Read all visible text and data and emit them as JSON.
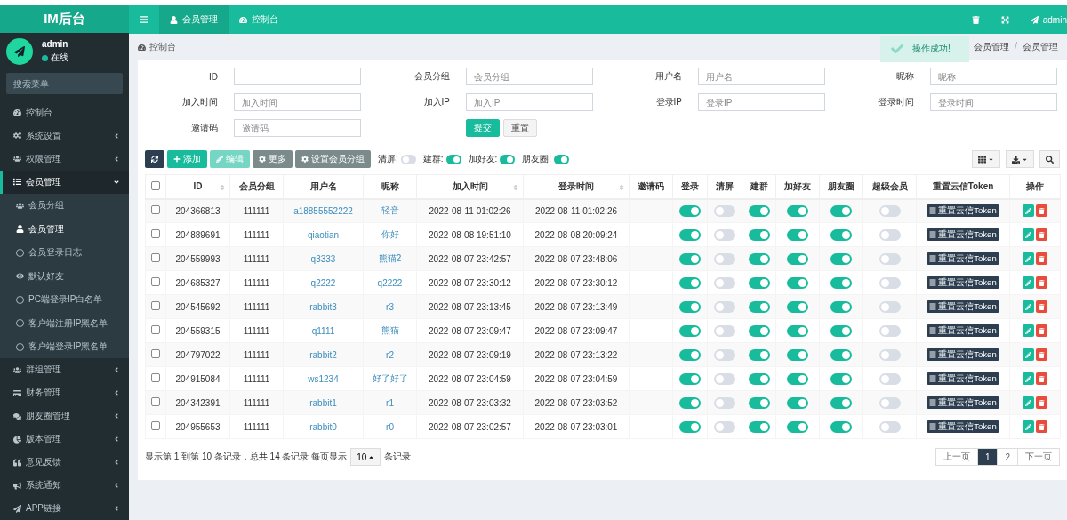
{
  "app": {
    "title": "IM后台"
  },
  "header": {
    "tabs": [
      {
        "label": "会员管理",
        "selected": true,
        "kind": "user"
      },
      {
        "label": "控制台",
        "selected": false,
        "kind": "dashboard"
      }
    ],
    "user": "admin"
  },
  "sidebar": {
    "user": {
      "name": "admin",
      "status": "在线",
      "online": true
    },
    "search": {
      "placeholder": "搜索菜单"
    },
    "items": [
      {
        "label": "控制台",
        "expanded": false,
        "has_children": false,
        "selected": false
      },
      {
        "label": "系统设置",
        "expanded": false,
        "has_children": true,
        "selected": false
      },
      {
        "label": "权限管理",
        "expanded": false,
        "has_children": true,
        "selected": false
      },
      {
        "label": "会员管理",
        "expanded": true,
        "has_children": true,
        "selected": true,
        "children": [
          {
            "label": "会员分组",
            "selected": false
          },
          {
            "label": "会员管理",
            "selected": true
          },
          {
            "label": "会员登录日志",
            "selected": false
          },
          {
            "label": "默认好友",
            "selected": false
          },
          {
            "label": "PC端登录IP白名单",
            "selected": false
          },
          {
            "label": "客户端注册IP黑名单",
            "selected": false
          },
          {
            "label": "客户端登录IP黑名单",
            "selected": false
          }
        ]
      },
      {
        "label": "群组管理",
        "expanded": false,
        "has_children": true,
        "selected": false
      },
      {
        "label": "财务管理",
        "expanded": false,
        "has_children": true,
        "selected": false
      },
      {
        "label": "朋友圈管理",
        "expanded": false,
        "has_children": true,
        "selected": false
      },
      {
        "label": "版本管理",
        "expanded": false,
        "has_children": true,
        "selected": false
      },
      {
        "label": "意见反馈",
        "expanded": false,
        "has_children": true,
        "selected": false
      },
      {
        "label": "系统通知",
        "expanded": false,
        "has_children": true,
        "selected": false
      },
      {
        "label": "APP链接",
        "expanded": false,
        "has_children": true,
        "selected": false
      }
    ]
  },
  "breadcrumb": {
    "title": "控制台",
    "path": [
      "会员管理",
      "会员管理"
    ],
    "separator": "/"
  },
  "toast": {
    "message": "操作成功!"
  },
  "filters": [
    {
      "label": "ID"
    },
    {
      "label": "会员分组",
      "placeholder": "会员分组"
    },
    {
      "label": "用户名",
      "placeholder": "用户名"
    },
    {
      "label": "昵称",
      "placeholder": "昵称"
    },
    {
      "label": "加入时间",
      "placeholder": "加入时间"
    },
    {
      "label": "加入IP",
      "placeholder": "加入IP"
    },
    {
      "label": "登录IP",
      "placeholder": "登录IP"
    },
    {
      "label": "登录时间",
      "placeholder": "登录时间"
    },
    {
      "label": "邀请码",
      "placeholder": "邀请码"
    }
  ],
  "form_buttons": [
    "提交",
    "重置"
  ],
  "toolbar": {
    "buttons": [
      {
        "kind": "refresh",
        "disabled": false
      },
      {
        "kind": "add",
        "label": "添加",
        "disabled": false
      },
      {
        "kind": "edit",
        "label": "编辑",
        "disabled": true
      },
      {
        "kind": "more",
        "label": "更多",
        "disabled": false
      },
      {
        "kind": "group",
        "label": "设置会员分组",
        "disabled": false
      }
    ],
    "switches": [
      {
        "label": "清屏:",
        "on": false
      },
      {
        "label": "建群:",
        "on": true
      },
      {
        "label": "加好友:",
        "on": true
      },
      {
        "label": "朋友圈:",
        "on": true
      }
    ]
  },
  "table": {
    "select_all": false,
    "columns": [
      {
        "label": "ID",
        "sortable": true
      },
      {
        "label": "会员分组",
        "sortable": false
      },
      {
        "label": "用户名",
        "sortable": false
      },
      {
        "label": "昵称",
        "sortable": false
      },
      {
        "label": "加入时间",
        "sortable": true
      },
      {
        "label": "登录时间",
        "sortable": true
      },
      {
        "label": "邀请码",
        "sortable": false
      },
      {
        "label": "登录",
        "sortable": false
      },
      {
        "label": "清屏",
        "sortable": false
      },
      {
        "label": "建群",
        "sortable": false
      },
      {
        "label": "加好友",
        "sortable": false
      },
      {
        "label": "朋友圈",
        "sortable": false
      },
      {
        "label": "超级会员",
        "sortable": false
      },
      {
        "label": "重置云信Token",
        "sortable": false
      },
      {
        "label": "操作",
        "sortable": false
      }
    ],
    "rows": [
      {
        "checked": false,
        "id": "204366813",
        "group": "111111",
        "username": "a18855552222",
        "nickname": "轻音",
        "join_time": "2022-08-11 01:02:26",
        "login_time": "2022-08-11 01:02:26",
        "invite": "-",
        "switches": [
          true,
          false,
          true,
          true,
          true,
          false
        ],
        "token_button": "重置云信Token"
      },
      {
        "checked": false,
        "id": "204889691",
        "group": "111111",
        "username": "qiaotian",
        "nickname": "你好",
        "join_time": "2022-08-08 19:51:10",
        "login_time": "2022-08-08 20:09:24",
        "invite": "-",
        "switches": [
          true,
          false,
          true,
          true,
          true,
          false
        ],
        "token_button": "重置云信Token"
      },
      {
        "checked": false,
        "id": "204559993",
        "group": "111111",
        "username": "q3333",
        "nickname": "熊猫2",
        "join_time": "2022-08-07 23:42:57",
        "login_time": "2022-08-07 23:48:06",
        "invite": "-",
        "switches": [
          true,
          false,
          true,
          true,
          true,
          false
        ],
        "token_button": "重置云信Token"
      },
      {
        "checked": false,
        "id": "204685327",
        "group": "111111",
        "username": "q2222",
        "nickname": "q2222",
        "join_time": "2022-08-07 23:30:12",
        "login_time": "2022-08-07 23:30:12",
        "invite": "-",
        "switches": [
          true,
          false,
          true,
          true,
          true,
          false
        ],
        "token_button": "重置云信Token"
      },
      {
        "checked": false,
        "id": "204545692",
        "group": "111111",
        "username": "rabbit3",
        "nickname": "r3",
        "join_time": "2022-08-07 23:13:45",
        "login_time": "2022-08-07 23:13:49",
        "invite": "-",
        "switches": [
          true,
          false,
          true,
          true,
          true,
          false
        ],
        "token_button": "重置云信Token"
      },
      {
        "checked": false,
        "id": "204559315",
        "group": "111111",
        "username": "q1111",
        "nickname": "熊猫",
        "join_time": "2022-08-07 23:09:47",
        "login_time": "2022-08-07 23:09:47",
        "invite": "-",
        "switches": [
          true,
          false,
          true,
          true,
          true,
          false
        ],
        "token_button": "重置云信Token"
      },
      {
        "checked": false,
        "id": "204797022",
        "group": "111111",
        "username": "rabbit2",
        "nickname": "r2",
        "join_time": "2022-08-07 23:09:19",
        "login_time": "2022-08-07 23:13:22",
        "invite": "-",
        "switches": [
          true,
          false,
          true,
          true,
          true,
          false
        ],
        "token_button": "重置云信Token"
      },
      {
        "checked": false,
        "id": "204915084",
        "group": "111111",
        "username": "ws1234",
        "nickname": "好了好了",
        "join_time": "2022-08-07 23:04:59",
        "login_time": "2022-08-07 23:04:59",
        "invite": "-",
        "switches": [
          true,
          false,
          true,
          true,
          true,
          false
        ],
        "token_button": "重置云信Token"
      },
      {
        "checked": false,
        "id": "204342391",
        "group": "111111",
        "username": "rabbit1",
        "nickname": "r1",
        "join_time": "2022-08-07 23:03:32",
        "login_time": "2022-08-07 23:03:52",
        "invite": "-",
        "switches": [
          true,
          false,
          true,
          true,
          true,
          false
        ],
        "token_button": "重置云信Token"
      },
      {
        "checked": false,
        "id": "204955653",
        "group": "111111",
        "username": "rabbit0",
        "nickname": "r0",
        "join_time": "2022-08-07 23:02:57",
        "login_time": "2022-08-07 23:03:01",
        "invite": "-",
        "switches": [
          true,
          false,
          true,
          true,
          true,
          false
        ],
        "token_button": "重置云信Token"
      }
    ]
  },
  "footer": {
    "summary": "显示第 1 到第 10 条记录，总共 14 条记录 每页显示",
    "page_size": "10",
    "suffix": "条记录",
    "pages": [
      {
        "label": "上一页",
        "selected": false
      },
      {
        "label": "1",
        "selected": true
      },
      {
        "label": "2",
        "selected": false
      },
      {
        "label": "下一页",
        "selected": false
      }
    ]
  }
}
